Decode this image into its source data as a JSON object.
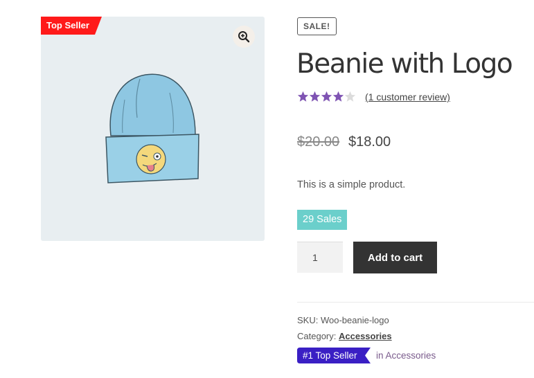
{
  "product": {
    "ribbon": "Top Seller",
    "sale_badge": "SALE!",
    "title": "Beanie with Logo",
    "rating": 4,
    "rating_max": 5,
    "review_link": "(1 customer review)",
    "old_price": "$20.00",
    "price": "$18.00",
    "description": "This is a simple product.",
    "sales_count": "29 Sales",
    "quantity": "1",
    "add_to_cart": "Add to cart"
  },
  "meta": {
    "sku_label": "SKU:",
    "sku": "Woo-beanie-logo",
    "category_label": "Category:",
    "category": "Accessories",
    "badge": "#1 Top Seller",
    "badge_context": "in Accessories"
  },
  "colors": {
    "ribbon": "#ff1a1a",
    "star": "#7f54b3",
    "sales_bg": "#6bcfcb",
    "badge": "#3a1fc4",
    "button": "#333333"
  },
  "icons": {
    "zoom": "magnifier-plus-icon"
  }
}
